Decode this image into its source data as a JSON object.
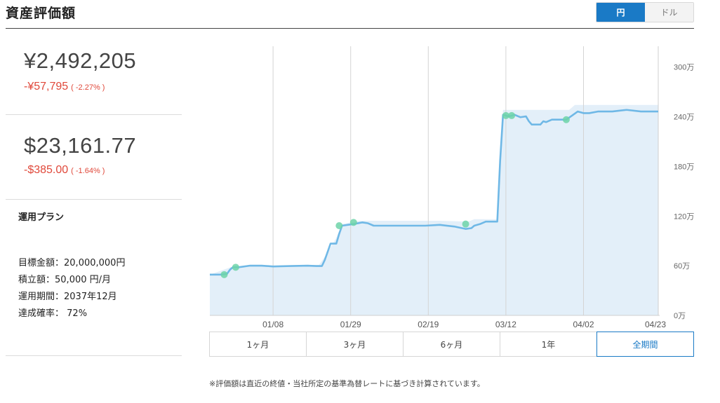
{
  "header": {
    "title": "資産評価額"
  },
  "currency_toggle": {
    "yen_label": "円",
    "dollar_label": "ドル",
    "selected": "円"
  },
  "summary": {
    "yen": {
      "value": "¥2,492,205",
      "change": "-¥57,795",
      "change_pct": "( -2.27% )"
    },
    "usd": {
      "value": "$23,161.77",
      "change": "-$385.00",
      "change_pct": "( -1.64% )"
    }
  },
  "plan": {
    "title": "運用プラン",
    "rows": [
      {
        "label": "目標金額：",
        "value": "20,000,000円"
      },
      {
        "label": "積立額：",
        "value": "50,000 円/月"
      },
      {
        "label": "運用期間：",
        "value": "2037年12月"
      },
      {
        "label": "達成確率：",
        "value": " 72%"
      }
    ]
  },
  "range_buttons": [
    "1ヶ月",
    "3ヶ月",
    "6ヶ月",
    "1年",
    "全期間"
  ],
  "range_selected": "全期間",
  "footnote": "※評価額は直近の終値・当社所定の基準為替レートに基づき計算されています。",
  "colors": {
    "accent": "#1a7ac6",
    "line": "#6fb8e6",
    "area": "#e3eff9",
    "marker": "#6dd3a8",
    "negative": "#e0483a"
  },
  "chart_data": {
    "type": "line",
    "x_tick_labels": [
      "01/08",
      "01/29",
      "02/19",
      "03/12",
      "04/02",
      "04/23"
    ],
    "y_tick_labels": [
      "0万",
      "60万",
      "120万",
      "180万",
      "240万",
      "300万"
    ],
    "ylim": [
      0,
      330
    ],
    "xlim": [
      0,
      124
    ],
    "grid": "vertical",
    "series": [
      {
        "values": [
          [
            0,
            50
          ],
          [
            4,
            50
          ],
          [
            6,
            51
          ],
          [
            7,
            56
          ],
          [
            8,
            59
          ],
          [
            10,
            59
          ],
          [
            14,
            61
          ],
          [
            18,
            61
          ],
          [
            22,
            60
          ],
          [
            28,
            60.5
          ],
          [
            34,
            61
          ],
          [
            37,
            60.5
          ],
          [
            39,
            60.5
          ],
          [
            40,
            68
          ],
          [
            42,
            88
          ],
          [
            44,
            88
          ],
          [
            45,
            100
          ],
          [
            46,
            110
          ],
          [
            48,
            111
          ],
          [
            50,
            112
          ],
          [
            53,
            114
          ],
          [
            55,
            113
          ],
          [
            57,
            110
          ],
          [
            60,
            110
          ],
          [
            65,
            110
          ],
          [
            70,
            110
          ],
          [
            75,
            110
          ],
          [
            80,
            111
          ],
          [
            85,
            109
          ],
          [
            89,
            106
          ],
          [
            91,
            107
          ],
          [
            92,
            110
          ],
          [
            94,
            112
          ],
          [
            96,
            115
          ],
          [
            99,
            115
          ],
          [
            100,
            115
          ],
          [
            101,
            190
          ],
          [
            102,
            246
          ],
          [
            104,
            244
          ],
          [
            106,
            246
          ],
          [
            108,
            243
          ],
          [
            110,
            244
          ],
          [
            111,
            238
          ],
          [
            112,
            234
          ],
          [
            115,
            234
          ],
          [
            116,
            238
          ],
          [
            117,
            237
          ],
          [
            119,
            240
          ],
          [
            121,
            240
          ],
          [
            124,
            240
          ],
          [
            126,
            245
          ],
          [
            128,
            250
          ],
          [
            130,
            248
          ],
          [
            132,
            248
          ],
          [
            135,
            250
          ],
          [
            140,
            250
          ],
          [
            145,
            252
          ],
          [
            150,
            250
          ],
          [
            156,
            250
          ]
        ]
      },
      {
        "area_top": [
          [
            0,
            50
          ],
          [
            8,
            60
          ],
          [
            38,
            62
          ],
          [
            40,
            72
          ],
          [
            44,
            95
          ],
          [
            46,
            112
          ],
          [
            52,
            116
          ],
          [
            70,
            116
          ],
          [
            80,
            116
          ],
          [
            90,
            115
          ],
          [
            92,
            118
          ],
          [
            100,
            118
          ],
          [
            101,
            200
          ],
          [
            102,
            252
          ],
          [
            125,
            252
          ],
          [
            127,
            258
          ],
          [
            156,
            258
          ]
        ]
      }
    ],
    "markers": [
      [
        5,
        50
      ],
      [
        9,
        59
      ],
      [
        45,
        110
      ],
      [
        50,
        114
      ],
      [
        89,
        112
      ],
      [
        103,
        245
      ],
      [
        105,
        245
      ],
      [
        124,
        240
      ]
    ]
  }
}
